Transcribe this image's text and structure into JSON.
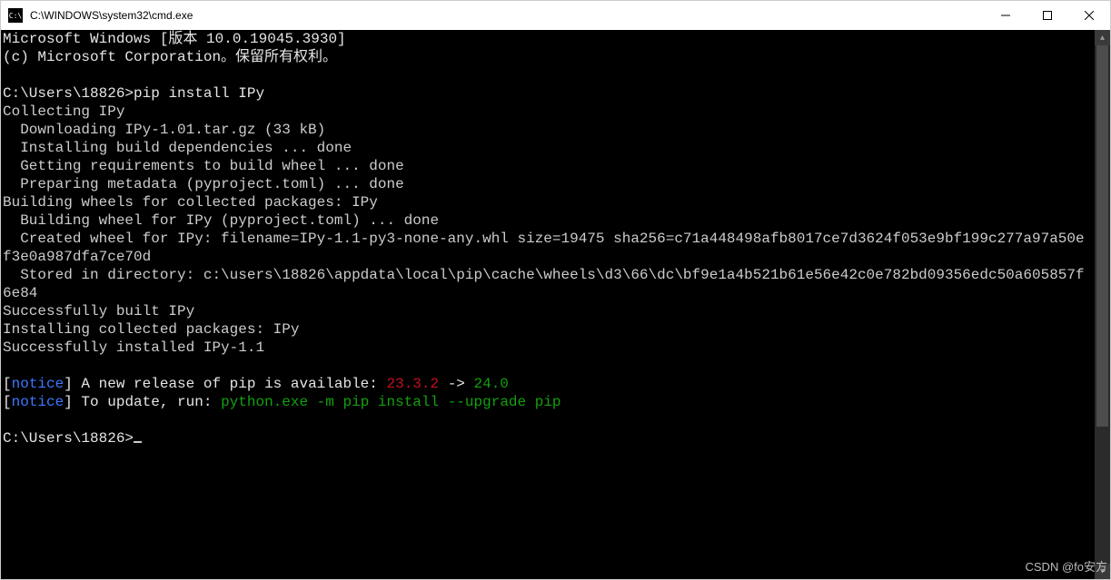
{
  "window": {
    "title": "C:\\WINDOWS\\system32\\cmd.exe",
    "icon_text": "C:\\"
  },
  "terminal": {
    "header1": "Microsoft Windows [版本 10.0.19045.3930]",
    "header2": "(c) Microsoft Corporation。保留所有权利。",
    "prompt1": "C:\\Users\\18826>",
    "cmd1": "pip install IPy",
    "out": {
      "l1": "Collecting IPy",
      "l2": "  Downloading IPy-1.01.tar.gz (33 kB)",
      "l3": "  Installing build dependencies ... done",
      "l4": "  Getting requirements to build wheel ... done",
      "l5": "  Preparing metadata (pyproject.toml) ... done",
      "l6": "Building wheels for collected packages: IPy",
      "l7": "  Building wheel for IPy (pyproject.toml) ... done",
      "l8": "  Created wheel for IPy: filename=IPy-1.1-py3-none-any.whl size=19475 sha256=c71a448498afb8017ce7d3624f053e9bf199c277a97a50ef3e0a987dfa7ce70d",
      "l9": "  Stored in directory: c:\\users\\18826\\appdata\\local\\pip\\cache\\wheels\\d3\\66\\dc\\bf9e1a4b521b61e56e42c0e782bd09356edc50a605857f6e84",
      "l10": "Successfully built IPy",
      "l11": "Installing collected packages: IPy",
      "l12": "Successfully installed IPy-1.1"
    },
    "notice1": {
      "open": "[",
      "tag": "notice",
      "close": "]",
      "text": " A new release of pip is available: ",
      "old": "23.3.2",
      "arrow": " -> ",
      "new": "24.0"
    },
    "notice2": {
      "open": "[",
      "tag": "notice",
      "close": "]",
      "text": " To update, run: ",
      "cmd": "python.exe -m pip install --upgrade pip"
    },
    "prompt2": "C:\\Users\\18826>"
  },
  "watermark": "CSDN @fo安方"
}
